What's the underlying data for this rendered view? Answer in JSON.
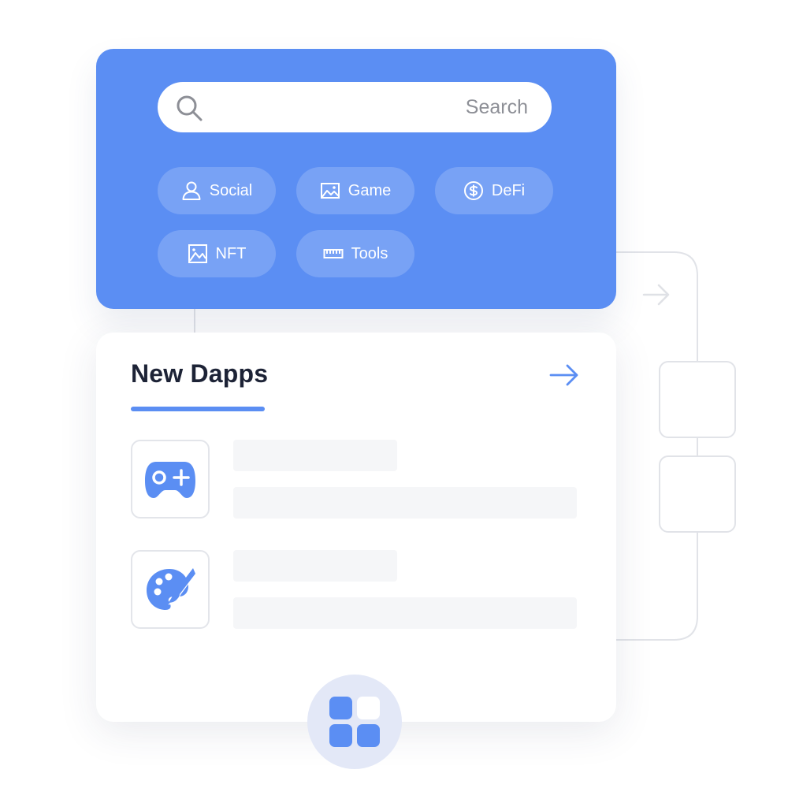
{
  "search": {
    "placeholder": "Search",
    "icon": "search-icon"
  },
  "categories": [
    {
      "label": "Social",
      "icon": "user-icon"
    },
    {
      "label": "Game",
      "icon": "image-frame-icon"
    },
    {
      "label": "DeFi",
      "icon": "dollar-coin-icon"
    },
    {
      "label": "NFT",
      "icon": "picture-icon"
    },
    {
      "label": "Tools",
      "icon": "ruler-icon"
    }
  ],
  "new_dapps": {
    "title": "New Dapps",
    "arrow_icon": "arrow-right-icon",
    "items": [
      {
        "icon": "gamepad-icon"
      },
      {
        "icon": "palette-icon"
      }
    ]
  },
  "apps_button": {
    "icon": "grid-icon"
  },
  "colors": {
    "accent": "#5b8ef3",
    "title": "#1d2336",
    "skeleton": "#f5f6f8",
    "border": "#e1e3e8"
  }
}
